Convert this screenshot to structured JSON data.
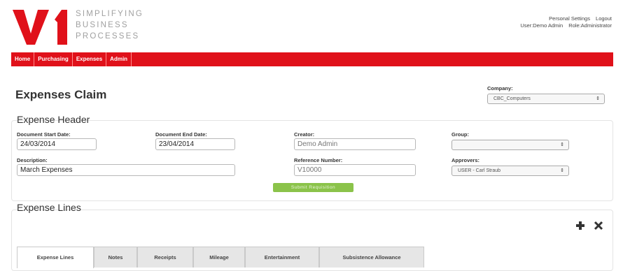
{
  "brand": {
    "logo_text": "V1",
    "logo_color": "#e0111a",
    "tagline": [
      "SIMPLIFYING",
      "BUSINESS",
      "PROCESSES"
    ]
  },
  "top_links": {
    "personal_settings": "Personal Settings",
    "logout": "Logout",
    "user": "User:Demo Admin",
    "role": "Role:Administrator"
  },
  "nav": {
    "items": [
      "Home",
      "Purchasing",
      "Expenses",
      "Admin"
    ],
    "color": "#e0111a"
  },
  "page": {
    "title": "Expenses Claim"
  },
  "company": {
    "label": "Company:",
    "value": "CBC_Computers"
  },
  "expense_header": {
    "title": "Expense Header",
    "start_date_label": "Document Start Date:",
    "start_date": "24/03/2014",
    "end_date_label": "Document End Date:",
    "end_date": "23/04/2014",
    "creator_label": "Creator:",
    "creator": "Demo Admin",
    "group_label": "Group:",
    "group": "",
    "description_label": "Description:",
    "description": "March Expenses",
    "reference_label": "Reference Number:",
    "reference": "V10000",
    "approvers_label": "Approvers:",
    "approver": "USER - Carl Straub",
    "submit_label": "Submit Requisition"
  },
  "expense_lines": {
    "title": "Expense Lines",
    "add_icon": "plus-icon",
    "delete_icon": "close-icon",
    "tabs": [
      "Expense Lines",
      "Notes",
      "Receipts",
      "Mileage",
      "Entertainment",
      "Subsistence Allowance"
    ],
    "active_tab": "Expense Lines"
  }
}
